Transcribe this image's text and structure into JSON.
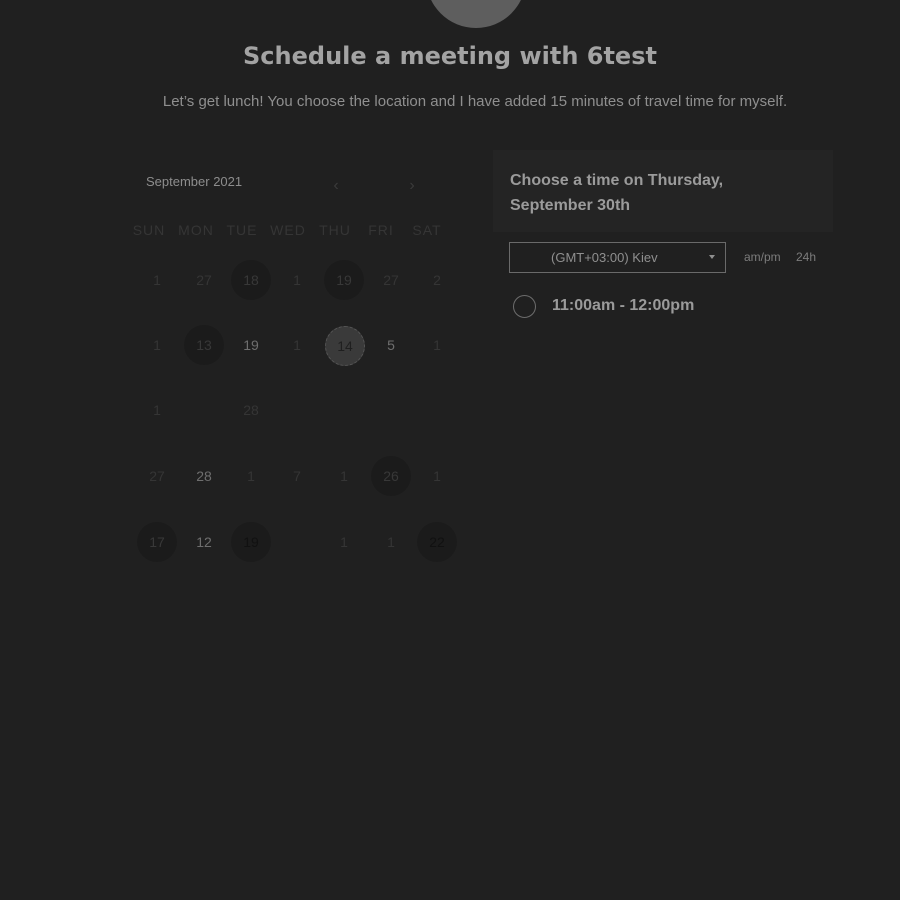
{
  "header": {
    "title": "Schedule a meeting with 6test",
    "description": "Let’s get lunch! You choose the location and I have added 15 minutes of travel time for myself."
  },
  "calendar": {
    "month_label": "September 2021",
    "weekdays": [
      "SUN",
      "MON",
      "TUE",
      "WED",
      "THU",
      "FRI",
      "SAT"
    ],
    "days": [
      {
        "label": "1"
      },
      {
        "label": "27"
      },
      {
        "label": "18"
      },
      {
        "label": "1"
      },
      {
        "label": "19"
      },
      {
        "label": "27"
      },
      {
        "label": "2"
      },
      {
        "label": "1"
      },
      {
        "label": "13"
      },
      {
        "label": "19"
      },
      {
        "label": "1"
      },
      {
        "label": "14"
      },
      {
        "label": "5"
      },
      {
        "label": "1"
      },
      {
        "label": "1"
      },
      {
        "label": ""
      },
      {
        "label": "28"
      },
      {
        "label": ""
      },
      {
        "label": ""
      },
      {
        "label": ""
      },
      {
        "label": ""
      },
      {
        "label": "27"
      },
      {
        "label": "28"
      },
      {
        "label": "1"
      },
      {
        "label": "7"
      },
      {
        "label": "1"
      },
      {
        "label": "26"
      },
      {
        "label": "1"
      },
      {
        "label": "17"
      },
      {
        "label": "12"
      },
      {
        "label": "19"
      },
      {
        "label": ""
      },
      {
        "label": "1"
      },
      {
        "label": "1"
      },
      {
        "label": "22"
      }
    ]
  },
  "time_panel": {
    "heading": "Choose a time on Thursday, September 30th",
    "timezone": "(GMT+03:00) Kiev",
    "format_ampm": "am/pm",
    "format_24h": "24h",
    "slots": [
      {
        "label": "11:00am - 12:00pm"
      }
    ]
  }
}
